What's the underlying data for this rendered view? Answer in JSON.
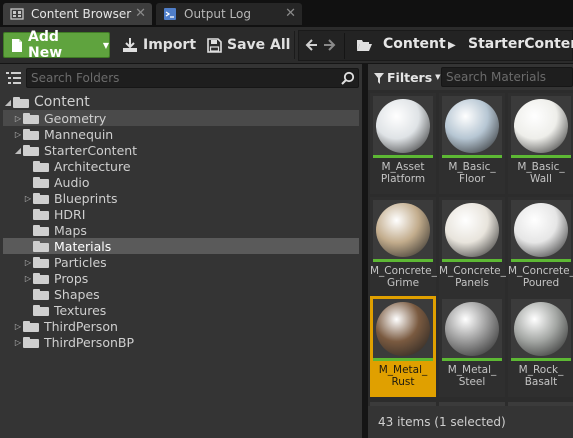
{
  "tabs": [
    {
      "label": "Content Browser",
      "active": true
    },
    {
      "label": "Output Log",
      "active": false
    }
  ],
  "toolbar": {
    "add_new_label": "Add New",
    "import_label": "Import",
    "save_all_label": "Save All"
  },
  "breadcrumb": [
    "Content",
    "StarterContent"
  ],
  "folder_search": {
    "placeholder": "Search Folders"
  },
  "tree": [
    {
      "label": "Content",
      "depth": 0,
      "expanded": true
    },
    {
      "label": "Geometry",
      "depth": 1,
      "expanded": false
    },
    {
      "label": "Mannequin",
      "depth": 1,
      "expanded": false
    },
    {
      "label": "StarterContent",
      "depth": 1,
      "expanded": true
    },
    {
      "label": "Architecture",
      "depth": 2
    },
    {
      "label": "Audio",
      "depth": 2
    },
    {
      "label": "Blueprints",
      "depth": 2,
      "expanded": false
    },
    {
      "label": "HDRI",
      "depth": 2
    },
    {
      "label": "Maps",
      "depth": 2
    },
    {
      "label": "Materials",
      "depth": 2,
      "selected": true
    },
    {
      "label": "Particles",
      "depth": 2,
      "expanded": false
    },
    {
      "label": "Props",
      "depth": 2,
      "expanded": false
    },
    {
      "label": "Shapes",
      "depth": 2
    },
    {
      "label": "Textures",
      "depth": 2
    },
    {
      "label": "ThirdPerson",
      "depth": 1,
      "expanded": false
    },
    {
      "label": "ThirdPersonBP",
      "depth": 1,
      "expanded": false
    }
  ],
  "filters": {
    "label": "Filters",
    "search_placeholder": "Search Materials"
  },
  "assets": [
    {
      "label": "M_Asset\nPlatform",
      "color": "#dfe3e6"
    },
    {
      "label": "M_Basic_\nFloor",
      "color": "#b6c6d3"
    },
    {
      "label": "M_Basic_\nWall",
      "color": "#eeeeea"
    },
    {
      "label": "M_Concrete_\nGrime",
      "color": "#c2ac8c"
    },
    {
      "label": "M_Concrete_\nPanels",
      "color": "#e8e4dc"
    },
    {
      "label": "M_Concrete_\nPoured",
      "color": "#e6e6e6"
    },
    {
      "label": "M_Metal_\nRust",
      "color": "#7a5a40",
      "selected": true
    },
    {
      "label": "M_Metal_\nSteel",
      "color": "#9a9a9a"
    },
    {
      "label": "M_Rock_\nBasalt",
      "color": "#a3a6a3"
    }
  ],
  "status": "43 items (1 selected)",
  "colors": {
    "accent_green": "#5fa33e",
    "selection": "#e0a000",
    "material_bar": "#5db834"
  }
}
